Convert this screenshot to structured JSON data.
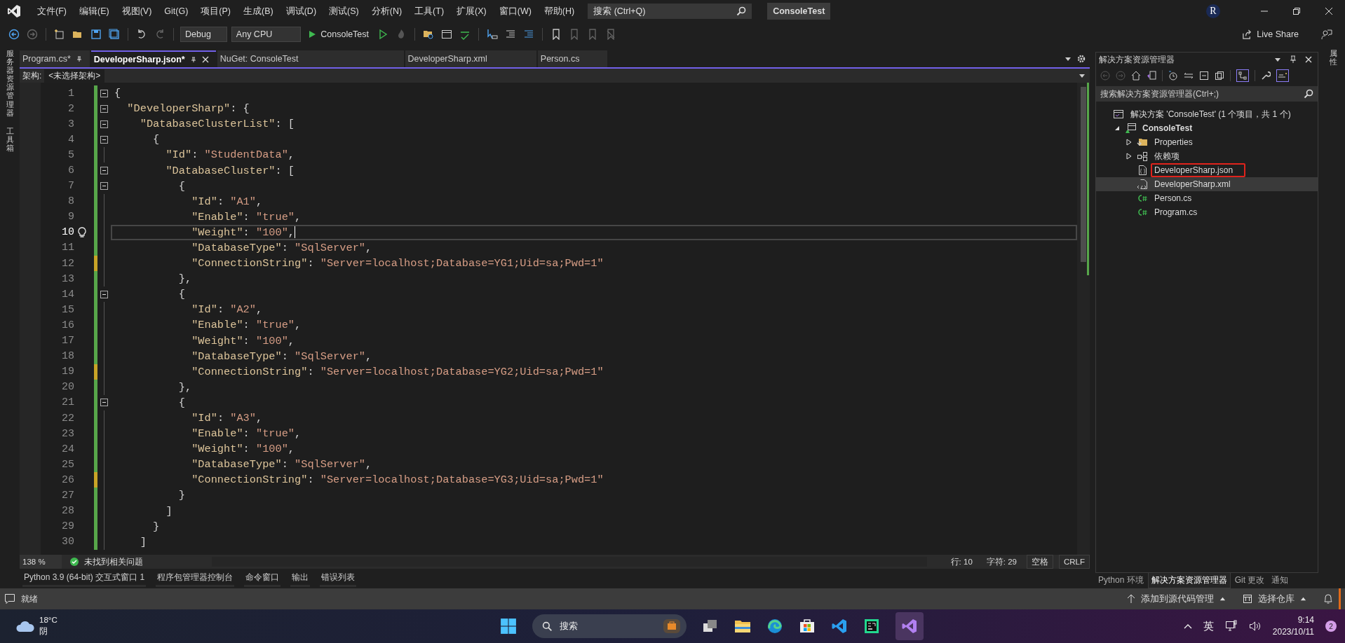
{
  "menubar": {
    "menus": [
      "文件(F)",
      "编辑(E)",
      "视图(V)",
      "Git(G)",
      "项目(P)",
      "生成(B)",
      "调试(D)",
      "测试(S)",
      "分析(N)",
      "工具(T)",
      "扩展(X)",
      "窗口(W)",
      "帮助(H)"
    ],
    "search": {
      "placeholder": "搜索 (Ctrl+Q)"
    },
    "solution_name": "ConsoleTest",
    "avatar": "R"
  },
  "toolbar": {
    "configuration": "Debug",
    "platform": "Any CPU",
    "run_target": "ConsoleTest",
    "live_share": "Live Share"
  },
  "left_strip": [
    "服务器资源管理器",
    "工具箱"
  ],
  "right_strip": [
    "属性"
  ],
  "tabs": [
    {
      "label": "Program.cs*",
      "selected": false,
      "pinned": true
    },
    {
      "label": "DeveloperSharp.json*",
      "selected": true,
      "pinned": true
    },
    {
      "label": "NuGet: ConsoleTest",
      "selected": false,
      "pinned": false
    },
    {
      "label": "DeveloperSharp.xml",
      "selected": false,
      "pinned": false
    },
    {
      "label": "Person.cs",
      "selected": false,
      "pinned": false
    }
  ],
  "schema_bar": {
    "label": "架构:",
    "value": "<未选择架构>"
  },
  "code_lines": [
    {
      "number": "1",
      "fold": true,
      "unsaved": false,
      "current": false,
      "tokens": [
        {
          "kind": "p",
          "text": "{"
        }
      ]
    },
    {
      "number": "2",
      "fold": true,
      "unsaved": false,
      "current": false,
      "tokens": [
        {
          "kind": "k",
          "text": "  \"DeveloperSharp\""
        },
        {
          "kind": "p",
          "text": ": {"
        }
      ]
    },
    {
      "number": "3",
      "fold": true,
      "unsaved": false,
      "current": false,
      "tokens": [
        {
          "kind": "k",
          "text": "    \"DatabaseClusterList\""
        },
        {
          "kind": "p",
          "text": ": ["
        }
      ]
    },
    {
      "number": "4",
      "fold": true,
      "unsaved": false,
      "current": false,
      "tokens": [
        {
          "kind": "p",
          "text": "      {"
        }
      ]
    },
    {
      "number": "5",
      "fold": false,
      "unsaved": false,
      "current": false,
      "tokens": [
        {
          "kind": "k",
          "text": "        \"Id\""
        },
        {
          "kind": "p",
          "text": ": "
        },
        {
          "kind": "s",
          "text": "\"StudentData\""
        },
        {
          "kind": "p",
          "text": ","
        }
      ]
    },
    {
      "number": "6",
      "fold": true,
      "unsaved": false,
      "current": false,
      "tokens": [
        {
          "kind": "k",
          "text": "        \"DatabaseCluster\""
        },
        {
          "kind": "p",
          "text": ": ["
        }
      ]
    },
    {
      "number": "7",
      "fold": true,
      "unsaved": false,
      "current": false,
      "tokens": [
        {
          "kind": "p",
          "text": "          {"
        }
      ]
    },
    {
      "number": "8",
      "fold": false,
      "unsaved": false,
      "current": false,
      "tokens": [
        {
          "kind": "k",
          "text": "            \"Id\""
        },
        {
          "kind": "p",
          "text": ": "
        },
        {
          "kind": "s",
          "text": "\"A1\""
        },
        {
          "kind": "p",
          "text": ","
        }
      ]
    },
    {
      "number": "9",
      "fold": false,
      "unsaved": false,
      "current": false,
      "tokens": [
        {
          "kind": "k",
          "text": "            \"Enable\""
        },
        {
          "kind": "p",
          "text": ": "
        },
        {
          "kind": "s",
          "text": "\"true\""
        },
        {
          "kind": "p",
          "text": ","
        }
      ]
    },
    {
      "number": "10",
      "fold": false,
      "unsaved": false,
      "current": true,
      "tokens": [
        {
          "kind": "k",
          "text": "            \"Weight\""
        },
        {
          "kind": "p",
          "text": ": "
        },
        {
          "kind": "s",
          "text": "\"100\""
        },
        {
          "kind": "p",
          "text": ","
        }
      ]
    },
    {
      "number": "11",
      "fold": false,
      "unsaved": false,
      "current": false,
      "tokens": [
        {
          "kind": "k",
          "text": "            \"DatabaseType\""
        },
        {
          "kind": "p",
          "text": ": "
        },
        {
          "kind": "s",
          "text": "\"SqlServer\""
        },
        {
          "kind": "p",
          "text": ","
        }
      ]
    },
    {
      "number": "12",
      "fold": false,
      "unsaved": true,
      "current": false,
      "tokens": [
        {
          "kind": "k",
          "text": "            \"ConnectionString\""
        },
        {
          "kind": "p",
          "text": ": "
        },
        {
          "kind": "s",
          "text": "\"Server=localhost;Database=YG1;Uid=sa;Pwd=1\""
        }
      ]
    },
    {
      "number": "13",
      "fold": false,
      "unsaved": false,
      "current": false,
      "tokens": [
        {
          "kind": "p",
          "text": "          },"
        }
      ]
    },
    {
      "number": "14",
      "fold": true,
      "unsaved": false,
      "current": false,
      "tokens": [
        {
          "kind": "p",
          "text": "          {"
        }
      ]
    },
    {
      "number": "15",
      "fold": false,
      "unsaved": false,
      "current": false,
      "tokens": [
        {
          "kind": "k",
          "text": "            \"Id\""
        },
        {
          "kind": "p",
          "text": ": "
        },
        {
          "kind": "s",
          "text": "\"A2\""
        },
        {
          "kind": "p",
          "text": ","
        }
      ]
    },
    {
      "number": "16",
      "fold": false,
      "unsaved": false,
      "current": false,
      "tokens": [
        {
          "kind": "k",
          "text": "            \"Enable\""
        },
        {
          "kind": "p",
          "text": ": "
        },
        {
          "kind": "s",
          "text": "\"true\""
        },
        {
          "kind": "p",
          "text": ","
        }
      ]
    },
    {
      "number": "17",
      "fold": false,
      "unsaved": false,
      "current": false,
      "tokens": [
        {
          "kind": "k",
          "text": "            \"Weight\""
        },
        {
          "kind": "p",
          "text": ": "
        },
        {
          "kind": "s",
          "text": "\"100\""
        },
        {
          "kind": "p",
          "text": ","
        }
      ]
    },
    {
      "number": "18",
      "fold": false,
      "unsaved": false,
      "current": false,
      "tokens": [
        {
          "kind": "k",
          "text": "            \"DatabaseType\""
        },
        {
          "kind": "p",
          "text": ": "
        },
        {
          "kind": "s",
          "text": "\"SqlServer\""
        },
        {
          "kind": "p",
          "text": ","
        }
      ]
    },
    {
      "number": "19",
      "fold": false,
      "unsaved": true,
      "current": false,
      "tokens": [
        {
          "kind": "k",
          "text": "            \"ConnectionString\""
        },
        {
          "kind": "p",
          "text": ": "
        },
        {
          "kind": "s",
          "text": "\"Server=localhost;Database=YG2;Uid=sa;Pwd=1\""
        }
      ]
    },
    {
      "number": "20",
      "fold": false,
      "unsaved": false,
      "current": false,
      "tokens": [
        {
          "kind": "p",
          "text": "          },"
        }
      ]
    },
    {
      "number": "21",
      "fold": true,
      "unsaved": false,
      "current": false,
      "tokens": [
        {
          "kind": "p",
          "text": "          {"
        }
      ]
    },
    {
      "number": "22",
      "fold": false,
      "unsaved": false,
      "current": false,
      "tokens": [
        {
          "kind": "k",
          "text": "            \"Id\""
        },
        {
          "kind": "p",
          "text": ": "
        },
        {
          "kind": "s",
          "text": "\"A3\""
        },
        {
          "kind": "p",
          "text": ","
        }
      ]
    },
    {
      "number": "23",
      "fold": false,
      "unsaved": false,
      "current": false,
      "tokens": [
        {
          "kind": "k",
          "text": "            \"Enable\""
        },
        {
          "kind": "p",
          "text": ": "
        },
        {
          "kind": "s",
          "text": "\"true\""
        },
        {
          "kind": "p",
          "text": ","
        }
      ]
    },
    {
      "number": "24",
      "fold": false,
      "unsaved": false,
      "current": false,
      "tokens": [
        {
          "kind": "k",
          "text": "            \"Weight\""
        },
        {
          "kind": "p",
          "text": ": "
        },
        {
          "kind": "s",
          "text": "\"100\""
        },
        {
          "kind": "p",
          "text": ","
        }
      ]
    },
    {
      "number": "25",
      "fold": false,
      "unsaved": false,
      "current": false,
      "tokens": [
        {
          "kind": "k",
          "text": "            \"DatabaseType\""
        },
        {
          "kind": "p",
          "text": ": "
        },
        {
          "kind": "s",
          "text": "\"SqlServer\""
        },
        {
          "kind": "p",
          "text": ","
        }
      ]
    },
    {
      "number": "26",
      "fold": false,
      "unsaved": true,
      "current": false,
      "tokens": [
        {
          "kind": "k",
          "text": "            \"ConnectionString\""
        },
        {
          "kind": "p",
          "text": ": "
        },
        {
          "kind": "s",
          "text": "\"Server=localhost;Database=YG3;Uid=sa;Pwd=1\""
        }
      ]
    },
    {
      "number": "27",
      "fold": false,
      "unsaved": false,
      "current": false,
      "tokens": [
        {
          "kind": "p",
          "text": "          }"
        }
      ]
    },
    {
      "number": "28",
      "fold": false,
      "unsaved": false,
      "current": false,
      "tokens": [
        {
          "kind": "p",
          "text": "        ]"
        }
      ]
    },
    {
      "number": "29",
      "fold": false,
      "unsaved": false,
      "current": false,
      "tokens": [
        {
          "kind": "p",
          "text": "      }"
        }
      ]
    },
    {
      "number": "30",
      "fold": false,
      "unsaved": false,
      "current": false,
      "tokens": [
        {
          "kind": "p",
          "text": "    ]"
        }
      ]
    }
  ],
  "editor_status": {
    "zoom": "138 %",
    "issues": "未找到相关问题",
    "line": "行: 10",
    "char": "字符: 29",
    "indent": "空格",
    "line_ending": "CRLF"
  },
  "tool_tabs": [
    "Python 3.9 (64-bit) 交互式窗口 1",
    "程序包管理器控制台",
    "命令窗口",
    "输出",
    "错误列表"
  ],
  "solution_explorer": {
    "title": "解决方案资源管理器",
    "search": {
      "placeholder": "搜索解决方案资源管理器(Ctrl+;)"
    },
    "tree": [
      {
        "label": "解决方案 'ConsoleTest' (1 个项目，共 1 个)",
        "kind": "solution",
        "selected": false,
        "marked": false,
        "children": [
          {
            "label": "ConsoleTest",
            "kind": "project",
            "selected": false,
            "marked": false,
            "expanded": true,
            "children": [
              {
                "label": "Properties",
                "kind": "folder",
                "selected": false,
                "marked": false,
                "expanded": false
              },
              {
                "label": "依赖项",
                "kind": "deps",
                "selected": false,
                "marked": false,
                "expanded": false
              },
              {
                "label": "DeveloperSharp.json",
                "kind": "json",
                "selected": false,
                "marked": true
              },
              {
                "label": "DeveloperSharp.xml",
                "kind": "xml",
                "selected": true,
                "marked": false
              },
              {
                "label": "Person.cs",
                "kind": "csharp",
                "selected": false,
                "marked": false
              },
              {
                "label": "Program.cs",
                "kind": "csharp",
                "selected": false,
                "marked": false
              }
            ]
          }
        ]
      }
    ],
    "tabs": [
      {
        "label": "Python 环境",
        "selected": false
      },
      {
        "label": "解决方案资源管理器",
        "selected": true
      },
      {
        "label": "Git 更改",
        "selected": false
      },
      {
        "label": "通知",
        "selected": false
      }
    ]
  },
  "status_bar": {
    "state": "就绪",
    "source_control": "添加到源代码管理",
    "repository": "选择仓库"
  },
  "taskbar": {
    "temperature": "18°C",
    "weather": "阴",
    "search": {
      "placeholder": "搜索"
    },
    "input_method": "英",
    "time": "9:14",
    "date": "2023/10/11",
    "notifications": "2"
  }
}
